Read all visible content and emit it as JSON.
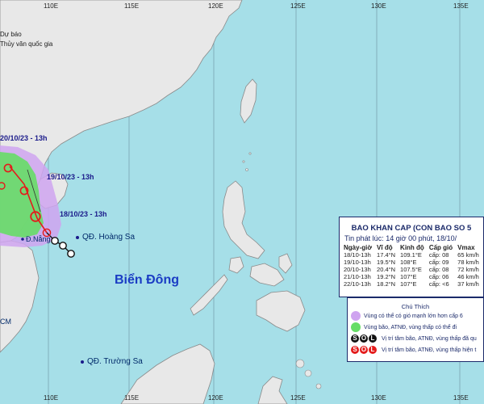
{
  "agency": {
    "line1": "Dự báo",
    "line2": "Thủy văn quốc gia"
  },
  "grid": {
    "longitudes": [
      "110E",
      "115E",
      "120E",
      "125E",
      "130E",
      "135E"
    ]
  },
  "labels": {
    "sea": "Biển Đông",
    "hoang_sa": "QĐ. Hoàng Sa",
    "truong_sa": "QĐ. Trường Sa",
    "da_nang": "Đ.Nẵng",
    "cm": "CM"
  },
  "track_labels": [
    "20/10/23 - 13h",
    "19/10/23 - 13h",
    "18/10/23 - 13h"
  ],
  "bulletin": {
    "title": "BAO KHAN CAP (CON BAO SO 5",
    "issued": "Tin phát lúc: 14 giờ 00 phút, 18/10/",
    "headers": [
      "Ngày-giờ",
      "Vĩ độ",
      "Kinh độ",
      "Cấp gió",
      "Vmax"
    ],
    "rows": [
      [
        "18/10-13h",
        "17.4°N",
        "109.1°E",
        "cấp: 08",
        "65 km/h"
      ],
      [
        "19/10-13h",
        "19.5°N",
        "108°E",
        "cấp: 09",
        "78 km/h"
      ],
      [
        "20/10-13h",
        "20.4°N",
        "107.5°E",
        "cấp: 08",
        "72 km/h"
      ],
      [
        "21/10-13h",
        "19.2°N",
        "107°E",
        "cấp: 06",
        "46 km/h"
      ],
      [
        "22/10-13h",
        "18.2°N",
        "107°E",
        "cấp: <6",
        "37 km/h"
      ]
    ]
  },
  "legend": {
    "title": "Chú Thích",
    "items": [
      {
        "text": "Vùng có thể có gió mạnh lớn hơn cấp 6",
        "color": "#cfa4f0"
      },
      {
        "text": "Vùng bão, ATNĐ, vùng thấp có thể đi",
        "color": "#66dd66"
      },
      {
        "text": "Vị trí tâm bão, ATNĐ, vùng thấp đã qu",
        "color": "#111111",
        "letters": [
          "S",
          "O",
          "L"
        ]
      },
      {
        "text": "Vị trí tâm bão, ATNĐ, vùng thấp hiện t",
        "color": "#e41b1b",
        "letters": [
          "S",
          "O",
          "L"
        ]
      }
    ]
  },
  "colors": {
    "sea": "#a6dfe8",
    "land": "#e8e8e8",
    "coast": "#8a8a8a",
    "warning_zone": "#cfa4f0",
    "storm_zone": "#66dd66",
    "forecast_symbol": "#e41b1b",
    "past_symbol": "#111111"
  }
}
